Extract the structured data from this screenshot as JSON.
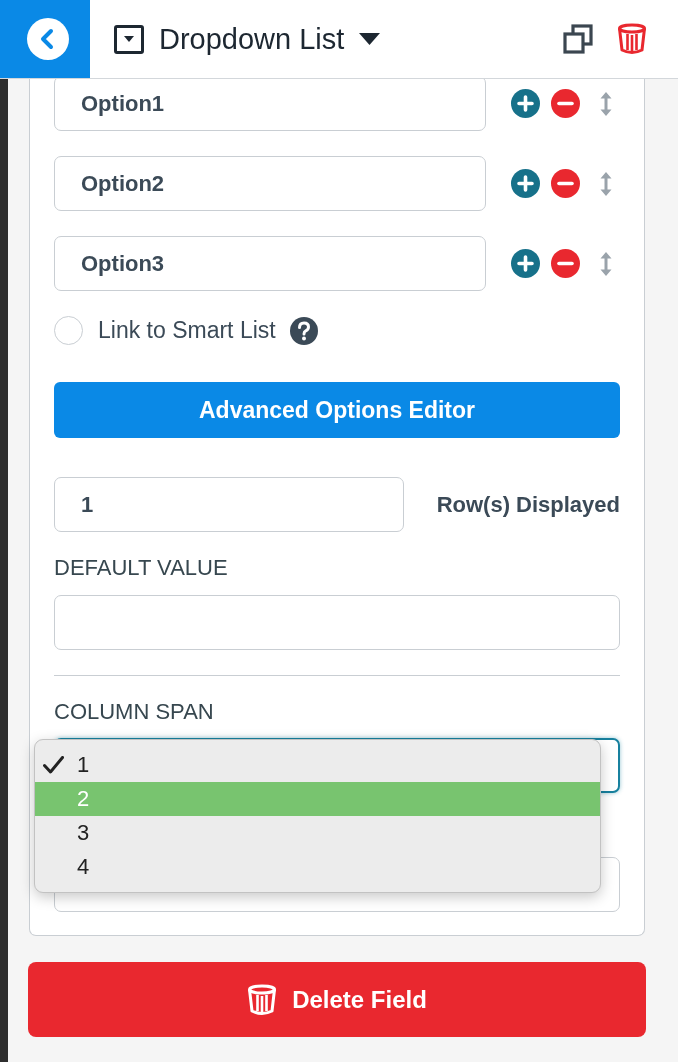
{
  "header": {
    "title": "Dropdown List"
  },
  "options": [
    {
      "value": "Option1"
    },
    {
      "value": "Option2"
    },
    {
      "value": "Option3"
    }
  ],
  "smart_list": {
    "label": "Link to Smart List",
    "checked": false
  },
  "advanced_button": {
    "label": "Advanced Options Editor"
  },
  "rows_displayed": {
    "value": "1",
    "label": "Row(s) Displayed"
  },
  "default_value": {
    "label": "DEFAULT VALUE"
  },
  "column_span": {
    "label": "COLUMN SPAN",
    "focused": true,
    "menu": [
      {
        "label": "1",
        "checked": true,
        "selected": false
      },
      {
        "label": "2",
        "checked": false,
        "selected": true
      },
      {
        "label": "3",
        "checked": false,
        "selected": false
      },
      {
        "label": "4",
        "checked": false,
        "selected": false
      }
    ]
  },
  "delete_button": {
    "label": "Delete Field"
  }
}
